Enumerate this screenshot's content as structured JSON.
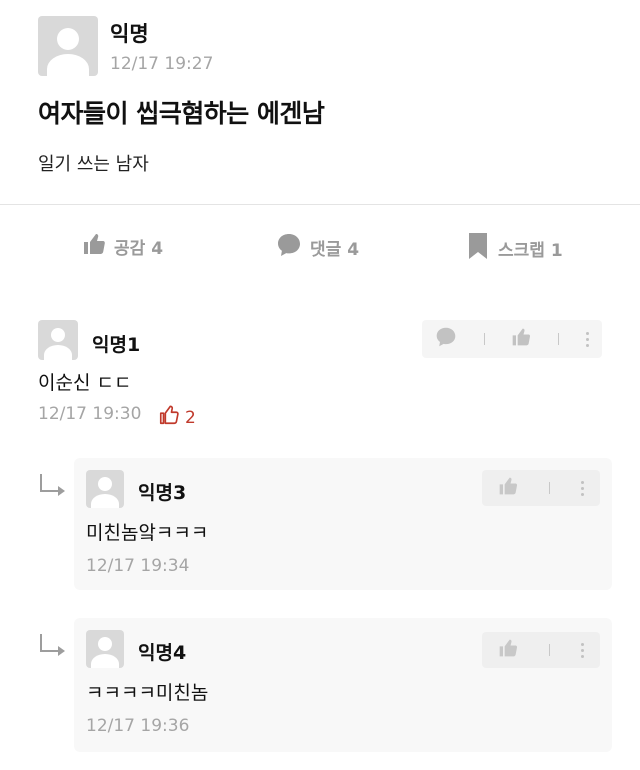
{
  "post": {
    "author": "익명",
    "time": "12/17 19:27",
    "title": "여자들이 씹극혐하는 에겐남",
    "body": "일기 쓰는 남자"
  },
  "stats": {
    "like_label": "공감 4",
    "comment_label": "댓글 4",
    "scrap_label": "스크랩 1"
  },
  "comments": [
    {
      "author": "익명1",
      "text": "이순신 ㄷㄷ",
      "time": "12/17 19:30",
      "likes": "2"
    }
  ],
  "replies": [
    {
      "author": "익명3",
      "text": "미친놈앜ㅋㅋㅋ",
      "time": "12/17 19:34"
    },
    {
      "author": "익명4",
      "text": "ㅋㅋㅋㅋ미친놈",
      "time": "12/17 19:36"
    }
  ],
  "icons": {
    "like": "thumbs-up-icon",
    "comment": "speech-bubble-icon",
    "scrap": "bookmark-icon",
    "more": "more-vertical-icon",
    "reply": "reply-arrow-icon"
  },
  "colors": {
    "accent_like": "#c0392b",
    "muted": "#9a9a9a",
    "divider": "#e4e4e4"
  }
}
